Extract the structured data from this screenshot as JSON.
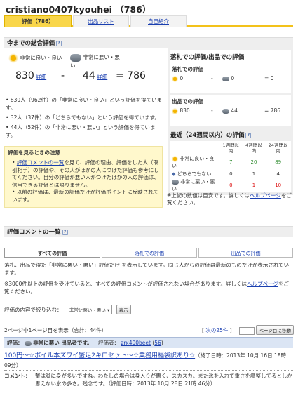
{
  "header": {
    "title": "cristiano0407kyouhei （786）"
  },
  "tabs": [
    {
      "label": "評価（786）"
    },
    {
      "label": "出品リスト"
    },
    {
      "label": "自己紹介"
    }
  ],
  "overall": {
    "heading": "今までの総合評価",
    "good_label": "非常に良い・良い",
    "bad_label": "非常に悪い・悪い",
    "good_count": "830",
    "bad_count": "44",
    "total": "786",
    "detail_link": "詳細",
    "minus": "-",
    "equals": "= 786",
    "bullets": [
      "830人（962件）の「非常に良い・良い」という評価を得ています。",
      "32人（37件）の「どちらでもない」という評価を得ています。",
      "44人（52件）の「非常に悪い・悪い」という評価を得ています。"
    ]
  },
  "note": {
    "heading": "評価を見るときの注意",
    "item1_link": "評価コメントの一覧",
    "item1_text": "を見て、評価の理由、評価をした人（取引相手）の評価や、その人がほかの人につけた評価も参考にしてください。自分の評価が悪い人がつけたほかの人の評価は、信用できる評価とは限りません。",
    "item2_text": "以前の評価は、最新の評価だけが評価ポイントに反映されています。"
  },
  "right": {
    "heading": "落札での評価/出品での評価",
    "buyer_label": "落札での評価",
    "buyer_good": "0",
    "buyer_bad": "0",
    "buyer_total": "= 0",
    "seller_label": "出品での評価",
    "seller_good": "830",
    "seller_bad": "44",
    "seller_total": "= 786",
    "recent_heading": "最近（24週間以内）の評価",
    "cols": [
      "1週間以内",
      "4週間以内",
      "24週間以内"
    ],
    "rows": [
      {
        "label": "非常に良い・良い",
        "values": [
          "7",
          "20",
          "89"
        ]
      },
      {
        "label": "どちらでもない",
        "values": [
          "0",
          "1",
          "4"
        ]
      },
      {
        "label": "非常に悪い・悪い",
        "values": [
          "0",
          "1",
          "10"
        ]
      }
    ],
    "footnote_pre": "※上記の数値は目安です。詳しくは",
    "footnote_link": "ヘルプページ",
    "footnote_post": "をご覧ください。"
  },
  "comments": {
    "heading": "評価コメントの一覧",
    "filter_tabs": [
      "すべての評価",
      "落札での評価",
      "出品での評価"
    ],
    "desc1": "落札、出品で得た「非常に悪い・悪い」評価だけ を表示しています。同じ人からの評価は最新のものだけが表示されています。",
    "desc2_pre": "※3000件以上の評価を受けていると、すべての評価コメントが評価されない場合があります。詳しくは",
    "desc2_link": "ヘルプページ",
    "desc2_post": "をご覧ください。",
    "filter_label": "評価の内容で絞り込む：",
    "filter_value": "非常に悪い・悪い",
    "filter_button": "表示",
    "paging": "2ページ中1ページ目を表示（合計：44件）",
    "next_link": "次の25件",
    "page_input": "",
    "page_button": "ページ目に移動",
    "item": {
      "eval_label": "評価：",
      "eval_value": "非常に悪い 出品者です。",
      "rater_label": "評価者：",
      "rater": "zrx400beet",
      "rater_score": "56",
      "item_link": "100円〜☆ボイル本ズワイ蟹足2キロセット〜☆業務用福袋訳あり☆",
      "end_time": "（終了日時：2013年 10月 16日 18時 09分）",
      "comment_label": "コメント：",
      "comment_text": "蟹は脚に身が多いですね。わたしの場合は身入りが悪く、スカスカ。また氷を入れて重さを調整してるとしか思えない氷の多さ。残念です。（評価日時：2013年 10月 28日 21時 46分）"
    }
  }
}
